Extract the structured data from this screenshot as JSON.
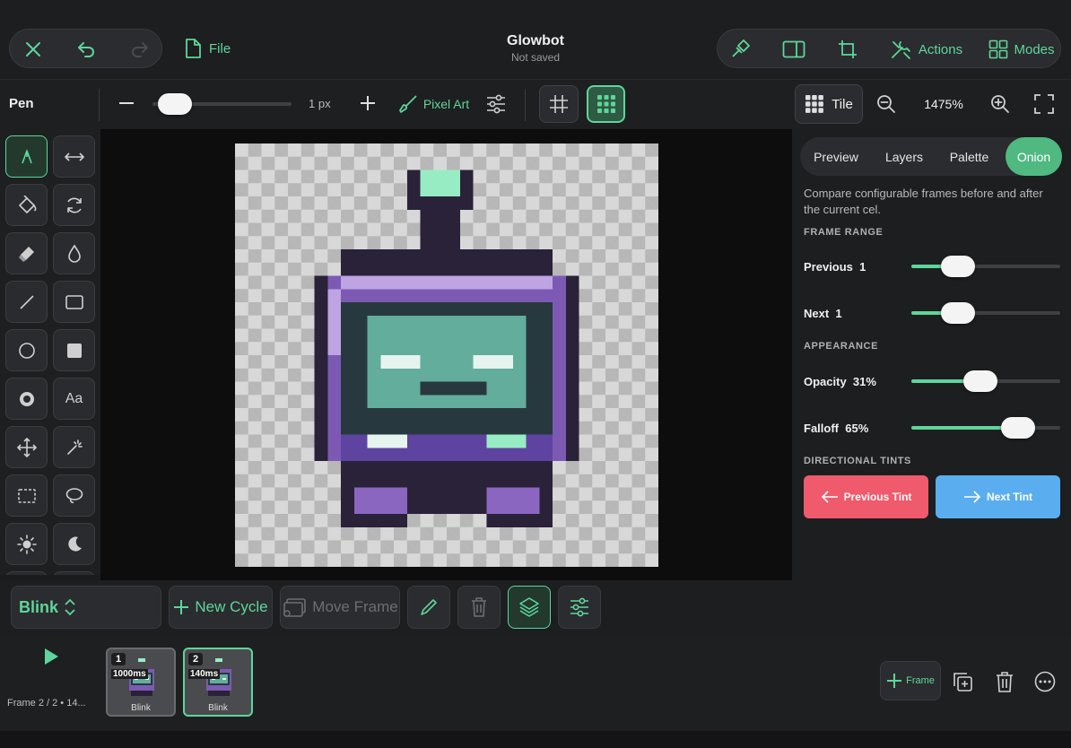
{
  "header": {
    "title": "Glowbot",
    "subtitle": "Not saved",
    "file_label": "File",
    "actions_label": "Actions",
    "modes_label": "Modes",
    "accent": "#5ed69a"
  },
  "toolbar": {
    "tool_name": "Pen",
    "size_value": "1 px",
    "brush_mode": "Pixel Art",
    "tile_label": "Tile",
    "zoom": "1475%",
    "size_level": 0.05
  },
  "tools": [
    {
      "icon": "pen-icon",
      "active": true
    },
    {
      "icon": "flip-horizontal-icon"
    },
    {
      "icon": "paint-bucket-icon"
    },
    {
      "icon": "rotate-icon"
    },
    {
      "icon": "eraser-icon"
    },
    {
      "icon": "dropper-icon"
    },
    {
      "icon": "line-icon"
    },
    {
      "icon": "rectangle-icon"
    },
    {
      "icon": "circle-icon"
    },
    {
      "icon": "filled-square-icon"
    },
    {
      "icon": "filled-circle-icon"
    },
    {
      "icon": "text-icon",
      "text": "Aa"
    },
    {
      "icon": "move-icon"
    },
    {
      "icon": "magic-wand-icon"
    },
    {
      "icon": "marquee-select-icon"
    },
    {
      "icon": "lasso-icon"
    },
    {
      "icon": "brightness-icon"
    },
    {
      "icon": "moon-icon"
    }
  ],
  "panel": {
    "tabs": [
      "Preview",
      "Layers",
      "Palette",
      "Onion"
    ],
    "active_tab": "Onion",
    "description": "Compare configurable frames before and after the current cel.",
    "frame_range_heading": "FRAME RANGE",
    "previous_label": "Previous",
    "previous_value": "1",
    "next_label": "Next",
    "next_value": "1",
    "appearance_heading": "APPEARANCE",
    "opacity_label": "Opacity",
    "opacity_value": "31%",
    "falloff_label": "Falloff",
    "falloff_value": "65%",
    "tints_heading": "DIRECTIONAL TINTS",
    "previous_tint_label": "Previous Tint",
    "next_tint_label": "Next Tint",
    "previous_tint_color": "#ef5a6c",
    "next_tint_color": "#5aaef0",
    "slider_levels": {
      "previous": 0.2,
      "next": 0.2,
      "opacity": 0.35,
      "falloff": 0.6
    }
  },
  "actions": {
    "cycle_name": "Blink",
    "new_cycle_label": "New Cycle",
    "move_frame_label": "Move Frame"
  },
  "timeline": {
    "status": "Frame 2 / 2 • 14...",
    "add_frame_label": "Frame",
    "frames": [
      {
        "number": "1",
        "duration": "1000ms",
        "name": "Blink"
      },
      {
        "number": "2",
        "duration": "140ms",
        "name": "Blink"
      }
    ]
  }
}
